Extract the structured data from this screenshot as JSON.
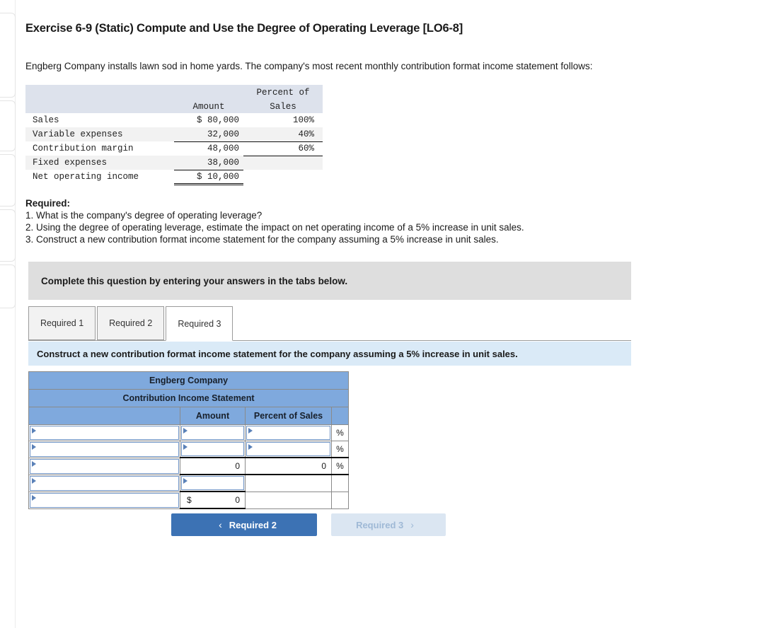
{
  "title": "Exercise 6-9 (Static) Compute and Use the Degree of Operating Leverage [LO6-8]",
  "intro": "Engberg Company installs lawn sod in home yards. The company's most recent monthly contribution format income statement follows:",
  "given_statement": {
    "headers": {
      "blank": "",
      "amount": "Amount",
      "percent_line1": "Percent of",
      "percent_line2": "Sales"
    },
    "rows": [
      {
        "label": "Sales",
        "amount": "$ 80,000",
        "percent": "100%"
      },
      {
        "label": "Variable expenses",
        "amount": "32,000",
        "percent": "40%"
      },
      {
        "label": "Contribution margin",
        "amount": "48,000",
        "percent": "60%"
      },
      {
        "label": "Fixed expenses",
        "amount": "38,000",
        "percent": ""
      },
      {
        "label": "Net operating income",
        "amount": "$ 10,000",
        "percent": ""
      }
    ]
  },
  "required": {
    "heading": "Required:",
    "items": [
      "1. What is the company's degree of operating leverage?",
      "2. Using the degree of operating leverage, estimate the impact on net operating income of a 5% increase in unit sales.",
      "3. Construct a new contribution format income statement for the company assuming a 5% increase in unit sales."
    ]
  },
  "instruction_bar": "Complete this question by entering your answers in the tabs below.",
  "tabs": [
    {
      "label": "Required 1",
      "active": false
    },
    {
      "label": "Required 2",
      "active": false
    },
    {
      "label": "Required 3",
      "active": true
    }
  ],
  "prompt_bar": "Construct a new contribution format income statement for the company assuming a 5% increase in unit sales.",
  "answer_table": {
    "company": "Engberg Company",
    "statement_title": "Contribution Income Statement",
    "columns": {
      "label": "",
      "amount": "Amount",
      "percent": "Percent of Sales",
      "symbol": ""
    },
    "rows": [
      {
        "label": "",
        "amount": "",
        "percent": "",
        "symbol": "%"
      },
      {
        "label": "",
        "amount": "",
        "percent": "",
        "symbol": "%"
      },
      {
        "label": "",
        "amount": "0",
        "percent": "0",
        "symbol": "%"
      },
      {
        "label": "",
        "amount": "",
        "percent": "",
        "symbol": ""
      },
      {
        "label": "",
        "amount": "0",
        "amount_prefix": "$",
        "percent": "",
        "symbol": ""
      }
    ]
  },
  "nav": {
    "prev_label": "Required 2",
    "prev_chevron": "‹",
    "next_label": "Required 3",
    "next_chevron": "›"
  },
  "colors": {
    "header_blue": "#7fa9dd",
    "prompt_blue": "#daeaf7",
    "instruction_gray": "#dedede",
    "button_blue": "#3c72b4",
    "button_disabled": "#dbe6f2",
    "given_header": "#dde2ec"
  }
}
